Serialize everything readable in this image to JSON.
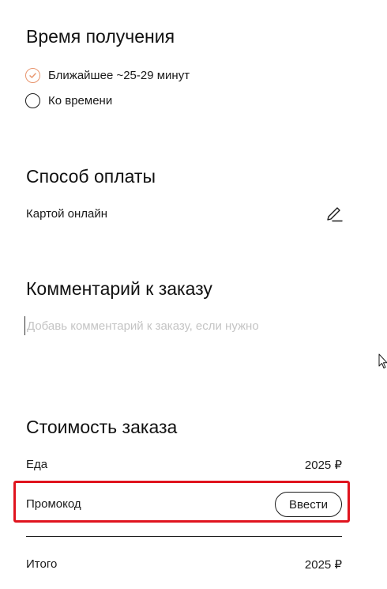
{
  "delivery_time": {
    "title": "Время получения",
    "options": [
      {
        "label": "Ближайшее ~25-29 минут",
        "selected": true
      },
      {
        "label": "Ко времени",
        "selected": false
      }
    ]
  },
  "payment": {
    "title": "Способ оплаты",
    "method": "Картой онлайн",
    "edit_icon": "pencil-icon"
  },
  "comment": {
    "title": "Комментарий к заказу",
    "placeholder": "Добавь комментарий к заказу, если нужно",
    "value": ""
  },
  "cost": {
    "title": "Стоимость заказа",
    "food_label": "Еда",
    "food_value": "2025 ₽",
    "promo_label": "Промокод",
    "promo_button": "Ввести",
    "total_label": "Итого",
    "total_value": "2025 ₽"
  },
  "colors": {
    "accent": "#e8956d",
    "highlight": "#e0141e",
    "text": "#1a1a1a",
    "placeholder": "#c4c4c4"
  }
}
